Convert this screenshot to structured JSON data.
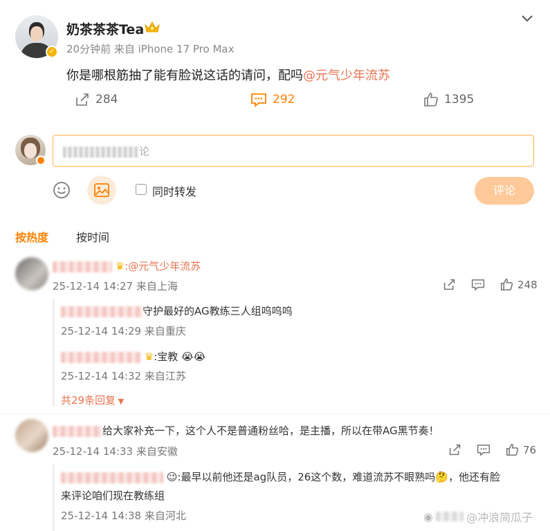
{
  "post": {
    "author": "奶茶茶茶Tea",
    "meta": "20分钟前  来自 iPhone 17 Pro Max",
    "text_main": "你是哪根筋抽了能有脸说这话的请问，配吗",
    "text_mention": "@元气少年流苏",
    "shares": "284",
    "comments": "292",
    "likes": "1395"
  },
  "composer": {
    "placeholder_tail": "论",
    "forward_label": "同时转发",
    "submit_label": "评论"
  },
  "tabs": {
    "hot": "按热度",
    "time": "按时间"
  },
  "comments": [
    {
      "mention": ":@元气少年流苏",
      "meta": "25-12-14 14:27 来自上海",
      "likes": "248",
      "replies": [
        {
          "text": "守护最好的AG教练三人组呜呜呜",
          "meta": "25-12-14 14:29 来自重庆"
        },
        {
          "text": ":宝教",
          "meta": "25-12-14 14:32 来自江苏"
        }
      ],
      "more_replies": "共29条回复"
    },
    {
      "text": "给大家补充一下，这个人不是普通粉丝哈，是主播，所以在带AG黑节奏！",
      "meta": "25-12-14 14:33 来自安徽",
      "likes": "76",
      "replies": [
        {
          "text": ":最早以前他还是ag队员，26这个数，难道流苏不眼熟吗",
          "text_tail": "，他还有脸",
          "text_line2": "来评论咱们现在教练组",
          "meta": "25-12-14 14:38 来自河北"
        }
      ]
    }
  ],
  "watermark": "@冲浪简瓜子",
  "colors": {
    "accent": "#ff8200",
    "mention": "#eb7350",
    "verify": "#f5b400"
  },
  "icons": [
    "crown-icon",
    "chevron-down-icon",
    "share-icon",
    "comment-icon",
    "like-icon",
    "emoji-icon",
    "image-icon"
  ]
}
